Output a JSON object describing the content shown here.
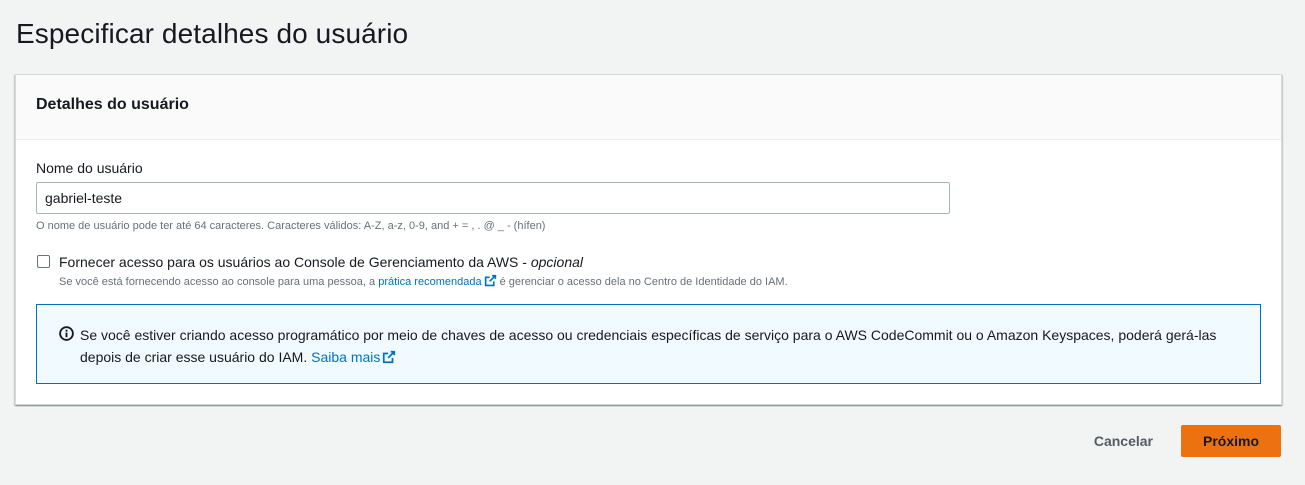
{
  "page": {
    "title": "Especificar detalhes do usuário"
  },
  "details_panel": {
    "header": "Detalhes do usuário",
    "username_label": "Nome do usuário",
    "username_value": "gabriel-teste",
    "username_constraint": "O nome de usuário pode ter até 64 caracteres. Caracteres válidos: A-Z, a-z, 0-9, and + = , . @ _ - (hífen)",
    "console_access": {
      "checked": false,
      "label": "Fornecer acesso para os usuários ao Console de Gerenciamento da AWS - ",
      "label_optional": "opcional",
      "desc_before": "Se você está fornecendo acesso ao console para uma pessoa, a ",
      "desc_link": "prática recomendada",
      "desc_after": " é gerenciar o acesso dela no Centro de Identidade do IAM."
    },
    "info": {
      "text": "Se você estiver criando acesso programático por meio de chaves de acesso ou credenciais específicas de serviço para o AWS CodeCommit ou o Amazon Keyspaces, poderá gerá-las depois de criar esse usuário do IAM. ",
      "link": "Saiba mais",
      "icon": "info-icon"
    }
  },
  "actions": {
    "cancel_label": "Cancelar",
    "next_label": "Próximo"
  },
  "colors": {
    "primary_button": "#ec7211",
    "link": "#0073bb",
    "info_border": "#0073bb",
    "info_background": "#f1faff",
    "page_background": "#f2f3f3"
  }
}
